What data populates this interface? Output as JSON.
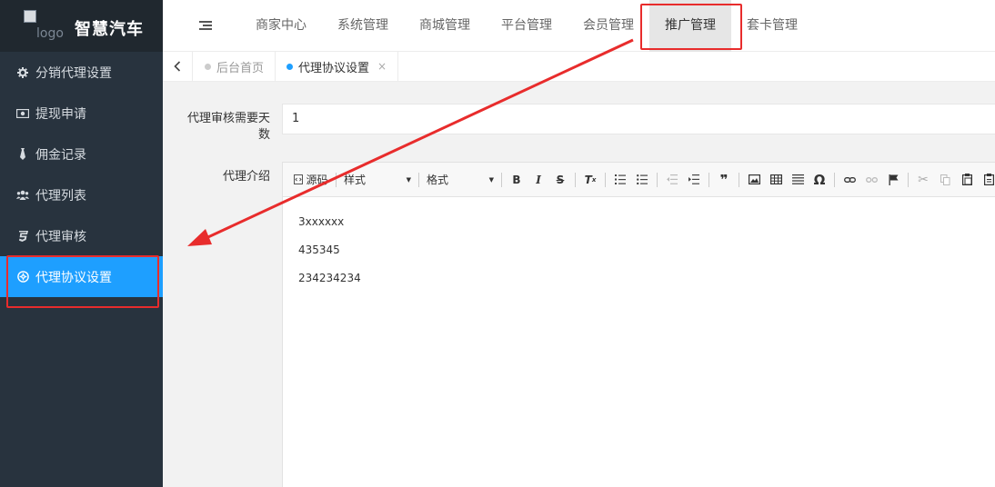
{
  "brand": {
    "logo_alt": "logo",
    "name": "智慧汽车"
  },
  "sidebar": {
    "items": [
      {
        "label": "分销代理设置",
        "icon": "gear-icon"
      },
      {
        "label": "提现申请",
        "icon": "money-icon"
      },
      {
        "label": "佣金记录",
        "icon": "tie-icon"
      },
      {
        "label": "代理列表",
        "icon": "users-icon"
      },
      {
        "label": "代理审核",
        "icon": "css3-icon"
      },
      {
        "label": "代理协议设置",
        "icon": "gear-circle-icon",
        "active": true
      }
    ]
  },
  "topnav": {
    "items": [
      {
        "label": "商家中心"
      },
      {
        "label": "系统管理"
      },
      {
        "label": "商城管理"
      },
      {
        "label": "平台管理"
      },
      {
        "label": "会员管理"
      },
      {
        "label": "推广管理",
        "active": true
      },
      {
        "label": "套卡管理"
      }
    ]
  },
  "tabs": {
    "items": [
      {
        "label": "后台首页"
      },
      {
        "label": "代理协议设置",
        "active": true,
        "close": "×"
      }
    ]
  },
  "form": {
    "days_label": "代理审核需要天数",
    "days_value": "1",
    "intro_label": "代理介绍"
  },
  "editor": {
    "toolbar": {
      "source": "源码",
      "style": "样式",
      "format": "格式"
    },
    "paragraphs": [
      "3xxxxxx",
      "435345",
      "234234234"
    ]
  },
  "colors": {
    "sidebar_bg": "#28333e",
    "brand_bg": "#20282f",
    "accent": "#1e9fff",
    "highlight_red": "#e82c2c"
  }
}
